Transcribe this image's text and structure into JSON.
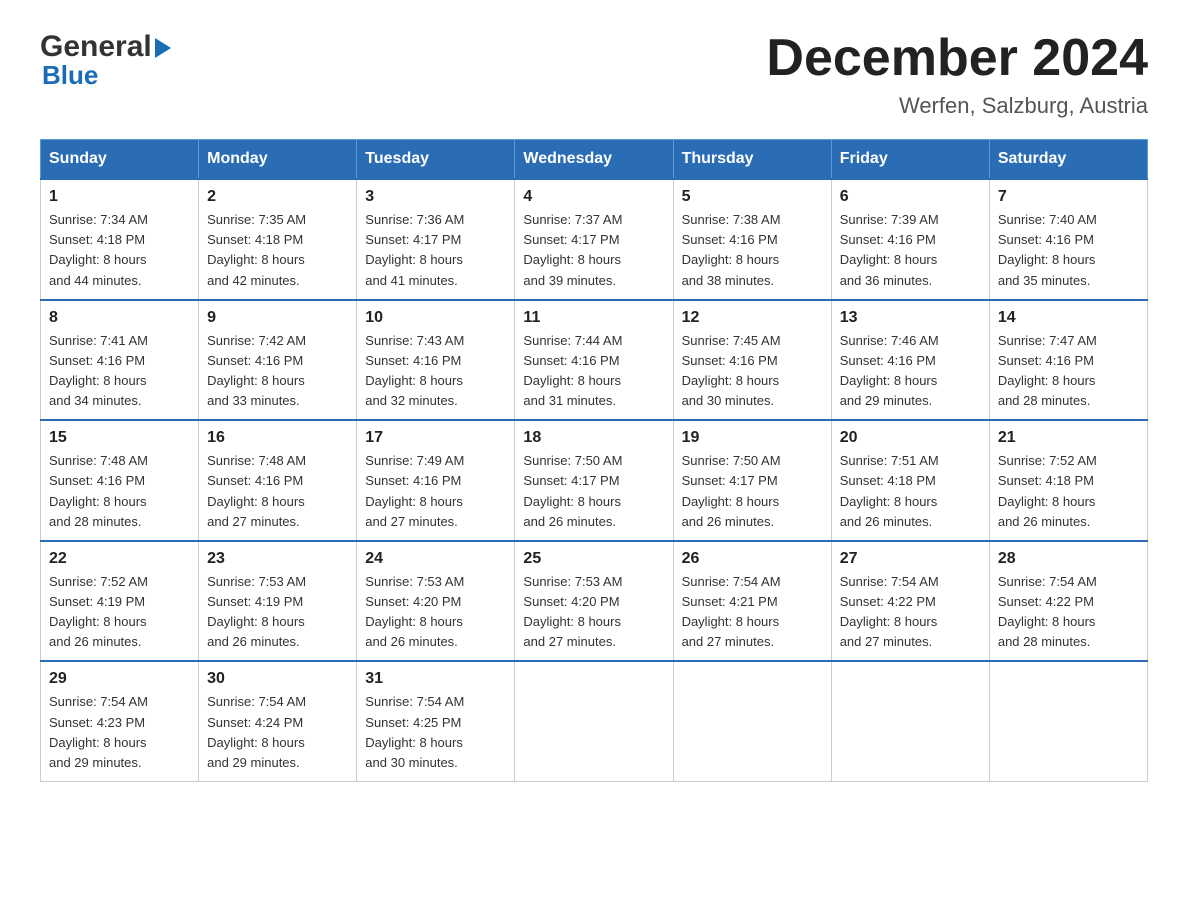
{
  "logo": {
    "general": "General",
    "blue": "Blue"
  },
  "title": "December 2024",
  "location": "Werfen, Salzburg, Austria",
  "days_of_week": [
    "Sunday",
    "Monday",
    "Tuesday",
    "Wednesday",
    "Thursday",
    "Friday",
    "Saturday"
  ],
  "weeks": [
    [
      {
        "day": "1",
        "sunrise": "7:34 AM",
        "sunset": "4:18 PM",
        "daylight": "8 hours and 44 minutes."
      },
      {
        "day": "2",
        "sunrise": "7:35 AM",
        "sunset": "4:18 PM",
        "daylight": "8 hours and 42 minutes."
      },
      {
        "day": "3",
        "sunrise": "7:36 AM",
        "sunset": "4:17 PM",
        "daylight": "8 hours and 41 minutes."
      },
      {
        "day": "4",
        "sunrise": "7:37 AM",
        "sunset": "4:17 PM",
        "daylight": "8 hours and 39 minutes."
      },
      {
        "day": "5",
        "sunrise": "7:38 AM",
        "sunset": "4:16 PM",
        "daylight": "8 hours and 38 minutes."
      },
      {
        "day": "6",
        "sunrise": "7:39 AM",
        "sunset": "4:16 PM",
        "daylight": "8 hours and 36 minutes."
      },
      {
        "day": "7",
        "sunrise": "7:40 AM",
        "sunset": "4:16 PM",
        "daylight": "8 hours and 35 minutes."
      }
    ],
    [
      {
        "day": "8",
        "sunrise": "7:41 AM",
        "sunset": "4:16 PM",
        "daylight": "8 hours and 34 minutes."
      },
      {
        "day": "9",
        "sunrise": "7:42 AM",
        "sunset": "4:16 PM",
        "daylight": "8 hours and 33 minutes."
      },
      {
        "day": "10",
        "sunrise": "7:43 AM",
        "sunset": "4:16 PM",
        "daylight": "8 hours and 32 minutes."
      },
      {
        "day": "11",
        "sunrise": "7:44 AM",
        "sunset": "4:16 PM",
        "daylight": "8 hours and 31 minutes."
      },
      {
        "day": "12",
        "sunrise": "7:45 AM",
        "sunset": "4:16 PM",
        "daylight": "8 hours and 30 minutes."
      },
      {
        "day": "13",
        "sunrise": "7:46 AM",
        "sunset": "4:16 PM",
        "daylight": "8 hours and 29 minutes."
      },
      {
        "day": "14",
        "sunrise": "7:47 AM",
        "sunset": "4:16 PM",
        "daylight": "8 hours and 28 minutes."
      }
    ],
    [
      {
        "day": "15",
        "sunrise": "7:48 AM",
        "sunset": "4:16 PM",
        "daylight": "8 hours and 28 minutes."
      },
      {
        "day": "16",
        "sunrise": "7:48 AM",
        "sunset": "4:16 PM",
        "daylight": "8 hours and 27 minutes."
      },
      {
        "day": "17",
        "sunrise": "7:49 AM",
        "sunset": "4:16 PM",
        "daylight": "8 hours and 27 minutes."
      },
      {
        "day": "18",
        "sunrise": "7:50 AM",
        "sunset": "4:17 PM",
        "daylight": "8 hours and 26 minutes."
      },
      {
        "day": "19",
        "sunrise": "7:50 AM",
        "sunset": "4:17 PM",
        "daylight": "8 hours and 26 minutes."
      },
      {
        "day": "20",
        "sunrise": "7:51 AM",
        "sunset": "4:18 PM",
        "daylight": "8 hours and 26 minutes."
      },
      {
        "day": "21",
        "sunrise": "7:52 AM",
        "sunset": "4:18 PM",
        "daylight": "8 hours and 26 minutes."
      }
    ],
    [
      {
        "day": "22",
        "sunrise": "7:52 AM",
        "sunset": "4:19 PM",
        "daylight": "8 hours and 26 minutes."
      },
      {
        "day": "23",
        "sunrise": "7:53 AM",
        "sunset": "4:19 PM",
        "daylight": "8 hours and 26 minutes."
      },
      {
        "day": "24",
        "sunrise": "7:53 AM",
        "sunset": "4:20 PM",
        "daylight": "8 hours and 26 minutes."
      },
      {
        "day": "25",
        "sunrise": "7:53 AM",
        "sunset": "4:20 PM",
        "daylight": "8 hours and 27 minutes."
      },
      {
        "day": "26",
        "sunrise": "7:54 AM",
        "sunset": "4:21 PM",
        "daylight": "8 hours and 27 minutes."
      },
      {
        "day": "27",
        "sunrise": "7:54 AM",
        "sunset": "4:22 PM",
        "daylight": "8 hours and 27 minutes."
      },
      {
        "day": "28",
        "sunrise": "7:54 AM",
        "sunset": "4:22 PM",
        "daylight": "8 hours and 28 minutes."
      }
    ],
    [
      {
        "day": "29",
        "sunrise": "7:54 AM",
        "sunset": "4:23 PM",
        "daylight": "8 hours and 29 minutes."
      },
      {
        "day": "30",
        "sunrise": "7:54 AM",
        "sunset": "4:24 PM",
        "daylight": "8 hours and 29 minutes."
      },
      {
        "day": "31",
        "sunrise": "7:54 AM",
        "sunset": "4:25 PM",
        "daylight": "8 hours and 30 minutes."
      },
      null,
      null,
      null,
      null
    ]
  ],
  "labels": {
    "sunrise": "Sunrise:",
    "sunset": "Sunset:",
    "daylight": "Daylight:"
  }
}
